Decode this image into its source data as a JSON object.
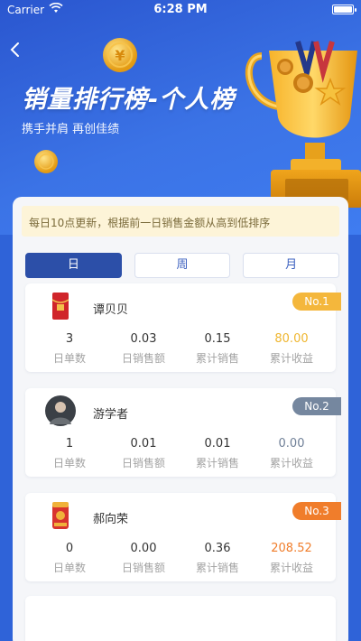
{
  "status_bar": {
    "carrier": "Carrier",
    "time": "6:28 PM"
  },
  "header": {
    "title": "销量排行榜-个人榜",
    "subtitle": "携手并肩 再创佳绩"
  },
  "notice": "每日10点更新，根据前一日销售金额从高到低排序",
  "tabs": [
    {
      "label": "日",
      "active": true
    },
    {
      "label": "周",
      "active": false
    },
    {
      "label": "月",
      "active": false
    }
  ],
  "stat_labels": [
    "日单数",
    "日销售额",
    "累计销售",
    "累计收益"
  ],
  "ranking": [
    {
      "name": "谭贝贝",
      "rank": "No.1",
      "badge_color": "#f4b73c",
      "avatar_icon": "red-envelope-icon",
      "orders": "3",
      "daily_sales": "0.03",
      "total_sales": "0.15",
      "total_income": "80.00",
      "income_color": "#efb630"
    },
    {
      "name": "游学者",
      "rank": "No.2",
      "badge_color": "#75879f",
      "avatar_icon": "person-photo-icon",
      "orders": "1",
      "daily_sales": "0.01",
      "total_sales": "0.01",
      "total_income": "0.00",
      "income_color": "#6f7f97"
    },
    {
      "name": "郝向荣",
      "rank": "No.3",
      "badge_color": "#f07d2b",
      "avatar_icon": "product-package-icon",
      "orders": "0",
      "daily_sales": "0.00",
      "total_sales": "0.36",
      "total_income": "208.52",
      "income_color": "#f07d2b"
    }
  ]
}
